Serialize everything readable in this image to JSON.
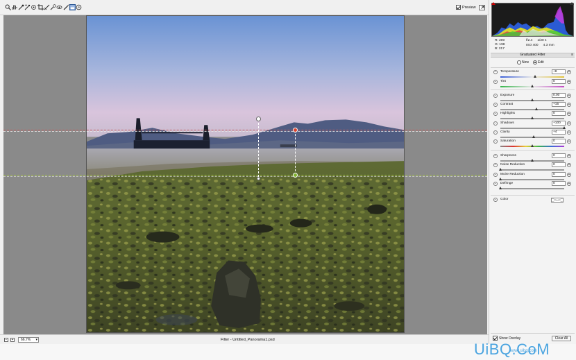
{
  "toolbar": {
    "tools": [
      {
        "name": "zoom-tool",
        "icon": "magnifier-icon"
      },
      {
        "name": "hand-tool",
        "icon": "hand-icon"
      },
      {
        "name": "white-balance-tool",
        "icon": "eyedropper-icon"
      },
      {
        "name": "color-sampler-tool",
        "icon": "eyedropper-plus-icon"
      },
      {
        "name": "targeted-adjustment-tool",
        "icon": "target-icon"
      },
      {
        "name": "crop-tool",
        "icon": "crop-icon"
      },
      {
        "name": "straighten-tool",
        "icon": "straighten-icon"
      },
      {
        "name": "spot-removal-tool",
        "icon": "spot-icon"
      },
      {
        "name": "red-eye-tool",
        "icon": "eye-icon"
      },
      {
        "name": "adjustment-brush-tool",
        "icon": "brush-icon"
      },
      {
        "name": "graduated-filter-tool",
        "icon": "graduated-filter-icon",
        "active": true
      },
      {
        "name": "radial-filter-tool",
        "icon": "radial-icon"
      }
    ],
    "preview_label": "Preview",
    "preview_checked": true
  },
  "status": {
    "zoom": "66.7%",
    "document_title": "Filter - Untitled_Panorama1.psd"
  },
  "readout": {
    "r": "R:  200",
    "g": "G:  198",
    "b": "B:  217",
    "aperture": "f/2.4",
    "shutter": "1/20 s",
    "iso": "ISO 400",
    "focal": "4.3 mm"
  },
  "panel": {
    "title": "Graduated Filter",
    "mode_new": "New",
    "mode_edit": "Edit",
    "sliders": [
      {
        "label": "Temperature",
        "value": "+8",
        "pos": 0.54,
        "track": "temp"
      },
      {
        "label": "Tint",
        "value": "0",
        "pos": 0.5,
        "track": "tint"
      },
      {
        "label": "Exposure",
        "value": "0.00",
        "pos": 0.5,
        "track": ""
      },
      {
        "label": "Contrast",
        "value": "+15",
        "pos": 0.57,
        "track": ""
      },
      {
        "label": "Highlights",
        "value": "0",
        "pos": 0.5,
        "track": ""
      },
      {
        "label": "Shadows",
        "value": "+100",
        "pos": 1.0,
        "track": ""
      },
      {
        "label": "Clarity",
        "value": "+4",
        "pos": 0.52,
        "track": ""
      },
      {
        "label": "Saturation",
        "value": "0",
        "pos": 0.5,
        "track": "sat"
      },
      {
        "label": "Sharpness",
        "value": "0",
        "pos": 0.5,
        "track": ""
      },
      {
        "label": "Noise Reduction",
        "value": "0",
        "pos": 0.0,
        "track": ""
      },
      {
        "label": "Moire Reduction",
        "value": "0",
        "pos": 0.0,
        "track": ""
      },
      {
        "label": "Defringe",
        "value": "0",
        "pos": 0.0,
        "track": ""
      }
    ],
    "color_label": "Color",
    "show_overlay_label": "Show Overlay",
    "show_overlay_checked": true,
    "clear_all_label": "Clear All"
  },
  "watermark": {
    "text": "UiBQ.CoM",
    "sub": "www.uibq.com"
  },
  "colors": {
    "accent": "#5a87c8",
    "pin_red": "#d8432f",
    "pin_green": "#7fb12f",
    "watermark": "#4aa4e0"
  }
}
